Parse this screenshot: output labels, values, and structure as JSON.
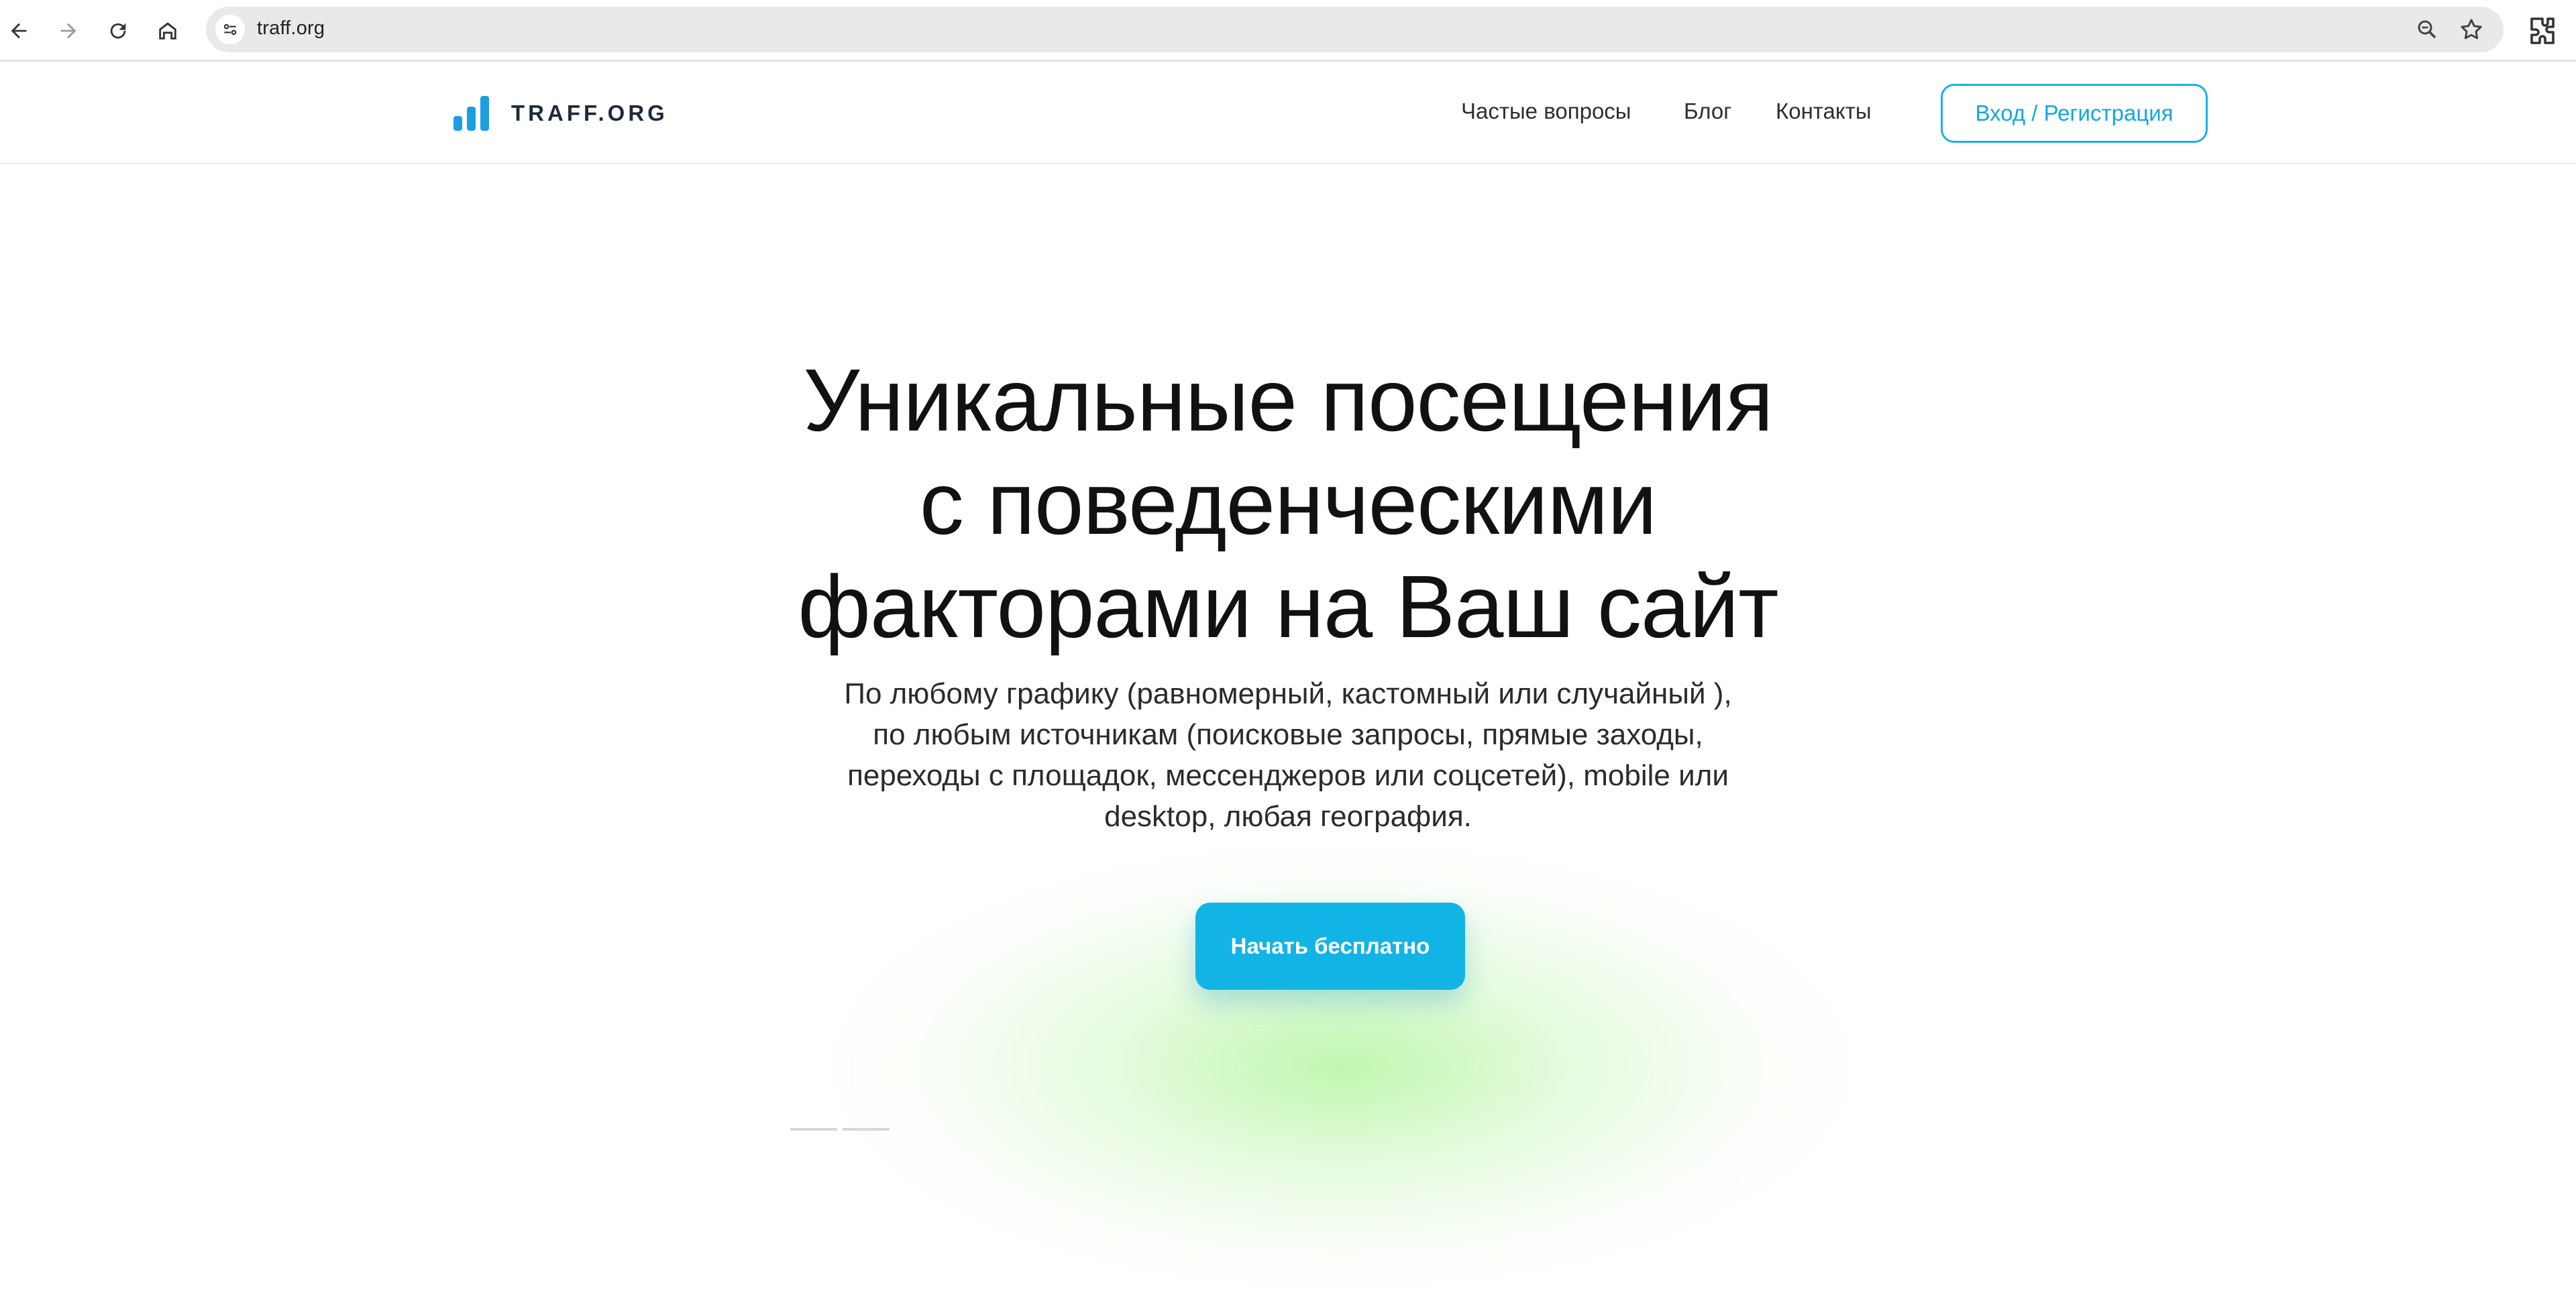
{
  "browser": {
    "url": "traff.org",
    "icons": [
      "back-arrow-icon",
      "forward-arrow-icon",
      "reload-icon",
      "home-icon",
      "site-info-icon",
      "zoom-icon",
      "bookmark-star-icon",
      "extensions-icon"
    ]
  },
  "header": {
    "logo_text": "TRAFF.ORG",
    "menu": [
      {
        "label": "Частые вопросы"
      },
      {
        "label": "Блог"
      },
      {
        "label": "Контакты"
      }
    ],
    "login_label": "Вход / Регистрация"
  },
  "hero": {
    "title_lines": [
      "Уникальные посещения",
      "с поведенческими",
      "факторами на Ваш сайт"
    ],
    "subtitle_lines": [
      "По любому графику (равномерный, кастомный или случайный ),",
      "по любым источникам (поисковые запросы, прямые заходы,",
      "переходы с площадок, мессенджеров или соцсетей), mobile или",
      "desktop, любая география."
    ],
    "cta_label": "Начать бесплатно"
  },
  "colors": {
    "accent": "#12b4e6",
    "logo_bars": "#1aa0e0",
    "glow": "#8cf06e"
  }
}
